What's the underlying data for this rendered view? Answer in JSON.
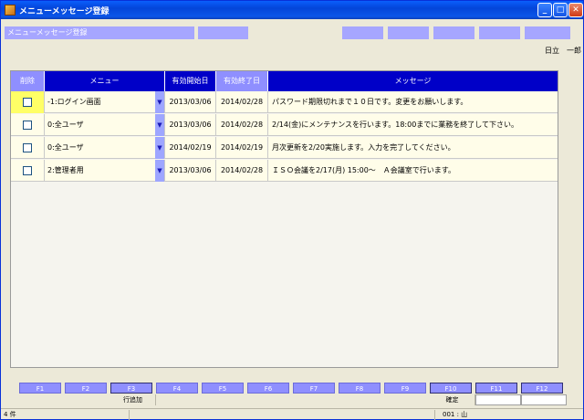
{
  "window": {
    "title": "メニューメッセージ登録"
  },
  "screen": {
    "label": "メニューメッセージ登録",
    "user": "日立　一郎"
  },
  "grid": {
    "headers": {
      "delete": "削除",
      "menu": "メニュー",
      "start": "有効開始日",
      "end": "有効終了日",
      "message": "メッセージ"
    },
    "rows": [
      {
        "menu": "-1:ログイン画面",
        "start": "2013/03/06",
        "end": "2014/02/28",
        "message": "パスワード期限切れまで１０日です。変更をお願いします。"
      },
      {
        "menu": "0:全ユーザ",
        "start": "2013/03/06",
        "end": "2014/02/28",
        "message": "2/14(金)にメンテナンスを行います。18:00までに業務を終了して下さい。"
      },
      {
        "menu": "0:全ユーザ",
        "start": "2014/02/19",
        "end": "2014/02/19",
        "message": "月次更新を2/20実施します。入力を完了してください。"
      },
      {
        "menu": "2:管理者用",
        "start": "2013/03/06",
        "end": "2014/02/28",
        "message": "ＩＳＯ会議を2/17(月) 15:00～　Ａ会議室で行います。"
      }
    ]
  },
  "fkeys": [
    "F1",
    "F2",
    "F3",
    "F4",
    "F5",
    "F6",
    "F7",
    "F8",
    "F9",
    "F10",
    "F11",
    "F12"
  ],
  "fkey_desc": {
    "f3": "行追加",
    "f10": "確定"
  },
  "status": {
    "count": "4 件",
    "code": "001 : 山"
  },
  "icons": {
    "minimize": "minimize-icon",
    "maximize": "maximize-icon",
    "close": "close-icon",
    "dropdown": "chevron-down-icon",
    "app": "app-icon"
  },
  "colors": {
    "header_bg": "#0000c8",
    "header_active": "#8f8fff",
    "fkey_bg": "#8f8fff",
    "row_bg": "#fffde9"
  }
}
